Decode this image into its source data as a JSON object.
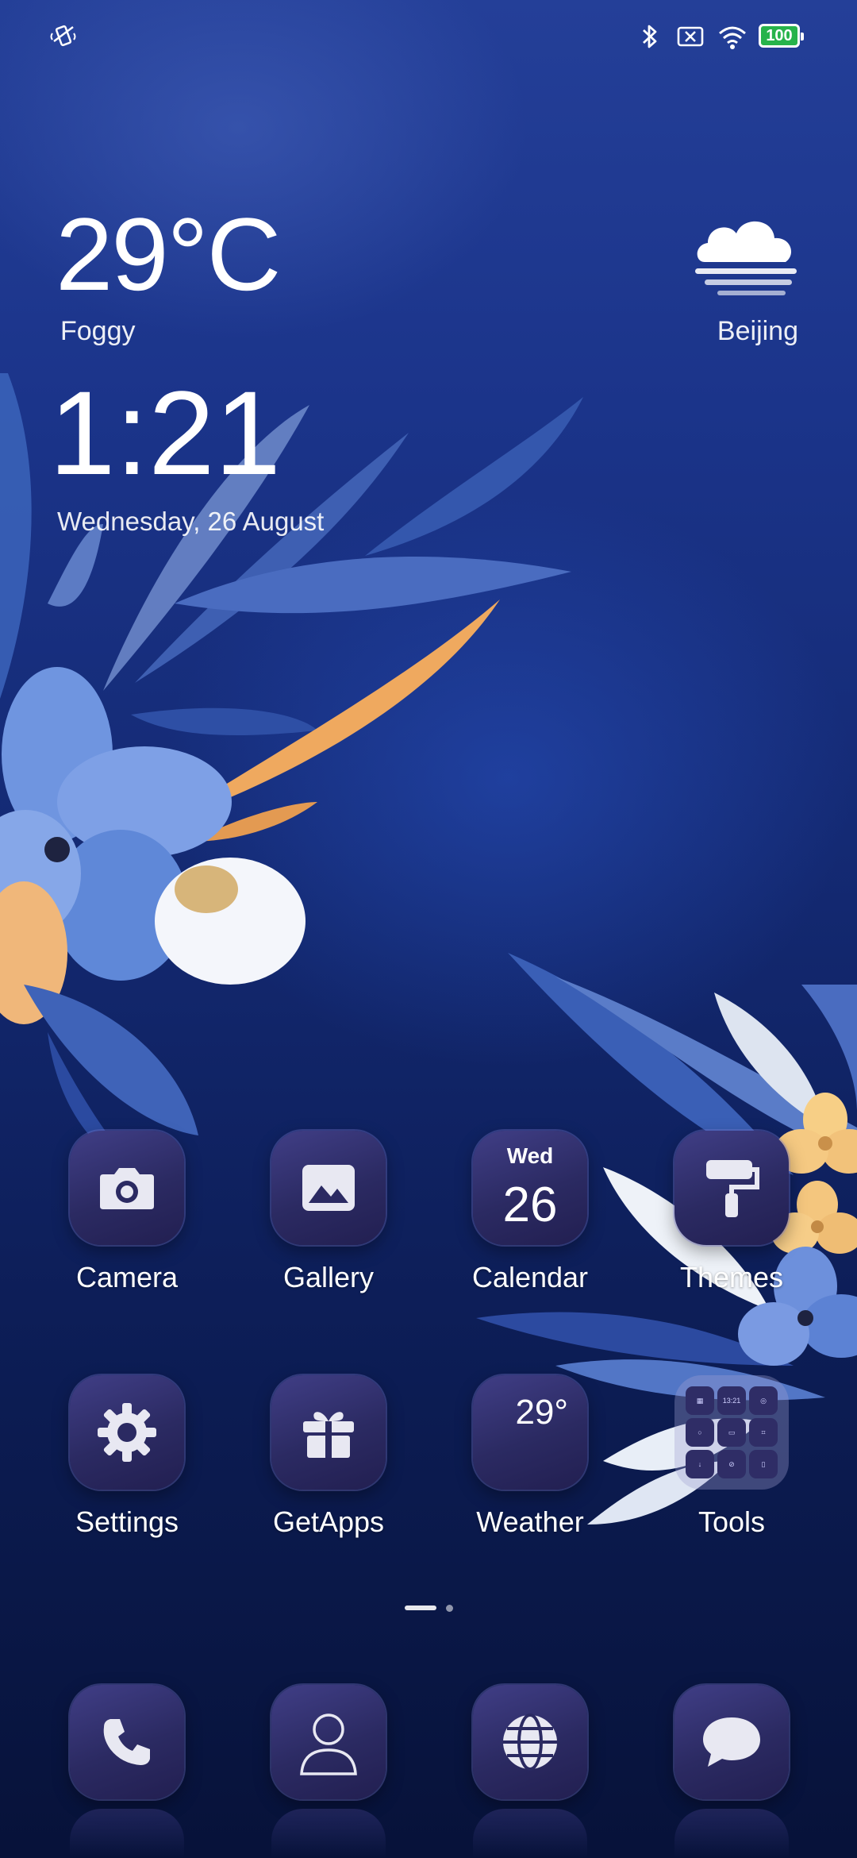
{
  "status_bar": {
    "left_icons": [
      "vibrate-icon"
    ],
    "right_icons": [
      "bluetooth-icon",
      "no-sim-icon",
      "wifi-icon"
    ],
    "battery_level": "100"
  },
  "weather_widget": {
    "temperature": "29°C",
    "condition": "Foggy",
    "city": "Beijing",
    "icon": "fog-cloud-icon"
  },
  "clock_widget": {
    "time": "1:21",
    "date": "Wednesday, 26 August"
  },
  "apps": {
    "row1": [
      {
        "label": "Camera",
        "icon": "camera-icon"
      },
      {
        "label": "Gallery",
        "icon": "gallery-icon"
      },
      {
        "label": "Calendar",
        "icon": "calendar-icon",
        "day": "Wed",
        "date": "26"
      },
      {
        "label": "Themes",
        "icon": "paint-roller-icon"
      }
    ],
    "row2": [
      {
        "label": "Settings",
        "icon": "gear-icon"
      },
      {
        "label": "GetApps",
        "icon": "gift-icon"
      },
      {
        "label": "Weather",
        "icon": "weather-icon",
        "temp": "29°"
      },
      {
        "label": "Tools",
        "icon": "folder-icon",
        "mini_time": "13:21"
      }
    ]
  },
  "page_indicator": {
    "pages": 2,
    "current": 1
  },
  "dock": [
    {
      "icon": "phone-icon"
    },
    {
      "icon": "contacts-icon"
    },
    {
      "icon": "browser-icon"
    },
    {
      "icon": "messages-icon"
    }
  ],
  "colors": {
    "background_top": "#243f98",
    "background_bottom": "#071239",
    "icon_bg": "#2b2a62",
    "battery_green": "#27b34b"
  }
}
